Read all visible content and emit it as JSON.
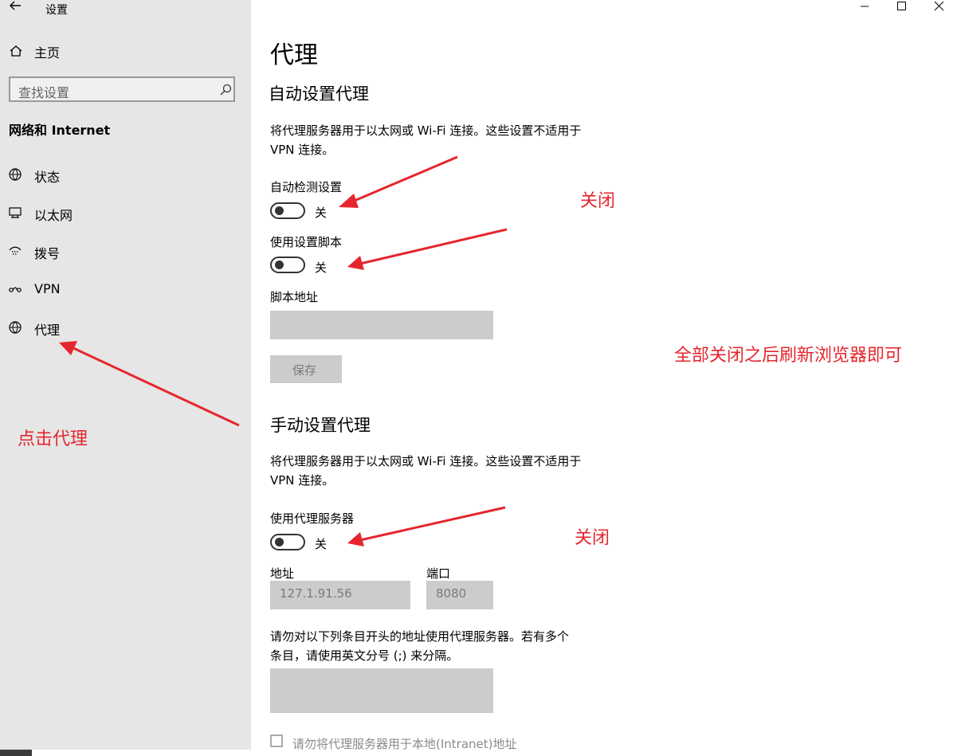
{
  "window": {
    "title": "设置"
  },
  "sidebar": {
    "home": "主页",
    "search_placeholder": "查找设置",
    "section_title": "网络和 Internet",
    "items": [
      {
        "label": "状态",
        "icon": "globe-status-icon"
      },
      {
        "label": "以太网",
        "icon": "ethernet-icon"
      },
      {
        "label": "拨号",
        "icon": "dialup-icon"
      },
      {
        "label": "VPN",
        "icon": "vpn-icon"
      },
      {
        "label": "代理",
        "icon": "globe-icon"
      }
    ]
  },
  "page": {
    "title": "代理",
    "auto": {
      "heading": "自动设置代理",
      "desc_line1": "将代理服务器用于以太网或 Wi-Fi 连接。这些设置不适用于",
      "desc_line2": "VPN 连接。",
      "detect_label": "自动检测设置",
      "detect_state": "关",
      "script_label": "使用设置脚本",
      "script_state": "关",
      "script_addr_label": "脚本地址",
      "script_addr_value": "",
      "save_label": "保存"
    },
    "manual": {
      "heading": "手动设置代理",
      "desc_line1": "将代理服务器用于以太网或 Wi-Fi 连接。这些设置不适用于",
      "desc_line2": "VPN 连接。",
      "proxy_label": "使用代理服务器",
      "proxy_state": "关",
      "address_label": "地址",
      "address_value": "127.1.91.56",
      "port_label": "端口",
      "port_value": "8080",
      "exceptions_line1": "请勿对以下列条目开头的地址使用代理服务器。若有多个",
      "exceptions_line2": "条目，请使用英文分号 (;) 来分隔。",
      "exceptions_value": "",
      "local_checkbox_label": "请勿将代理服务器用于本地(Intranet)地址"
    }
  },
  "annotations": {
    "click_proxy": "点击代理",
    "close_1": "关闭",
    "close_2": "关闭",
    "refresh_note": "全部关闭之后刷新浏览器即可",
    "color": "#e5262e"
  }
}
